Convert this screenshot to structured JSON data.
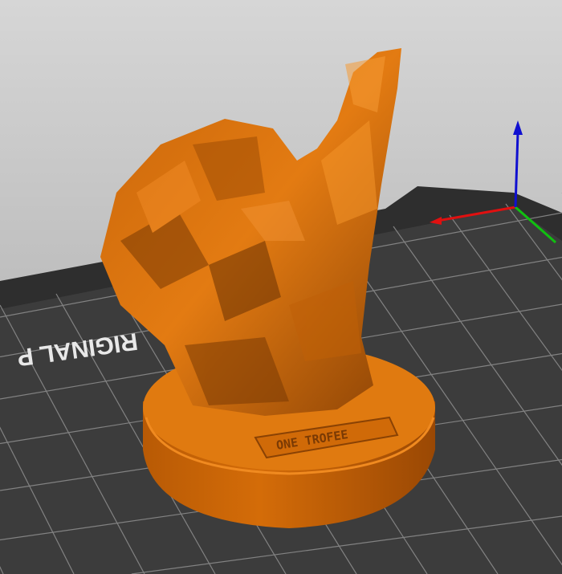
{
  "viewport": {
    "bed_label": "RIGINAL P",
    "model_plate_text": "ONE TROFEE",
    "colors": {
      "model": "#e07a10",
      "model_dark": "#a04e05",
      "bed": "#3c3c3c",
      "grid": "#8a8a8a",
      "axis_x": "#e01010",
      "axis_y": "#10c010",
      "axis_z": "#1010d0"
    }
  }
}
